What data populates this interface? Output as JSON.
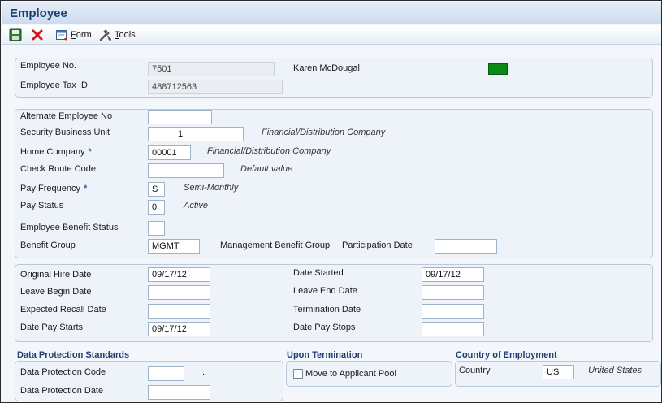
{
  "window": {
    "title": "Employee"
  },
  "toolbar": {
    "save_icon": "floppy-save-icon",
    "cancel_icon": "red-x-cancel-icon",
    "form_label_underline": "F",
    "form_label_rest": "orm",
    "tools_label_underline": "T",
    "tools_label_rest": "ools"
  },
  "header": {
    "employee_no_label": "Employee No.",
    "employee_no": "7501",
    "employee_name": "Karen McDougal",
    "tax_id_label": "Employee Tax ID",
    "tax_id": "488712563",
    "status_color": "#0a8a14"
  },
  "details": {
    "alt_employee_label": "Alternate Employee No",
    "alt_employee_value": "",
    "security_bu_label": "Security Business Unit",
    "security_bu_value": "1",
    "security_bu_desc": "Financial/Distribution Company",
    "home_company_label": "Home Company",
    "home_company_value": "00001",
    "home_company_desc": "Financial/Distribution Company",
    "check_route_label": "Check Route Code",
    "check_route_value": "",
    "check_route_desc": "Default value",
    "pay_frequency_label": "Pay Frequency",
    "pay_frequency_value": "S",
    "pay_frequency_desc": "Semi-Monthly",
    "pay_status_label": "Pay Status",
    "pay_status_value": "0",
    "pay_status_desc": "Active",
    "benefit_status_label": "Employee Benefit Status",
    "benefit_status_value": "",
    "benefit_group_label": "Benefit Group",
    "benefit_group_value": "MGMT",
    "benefit_group_desc": "Management Benefit Group",
    "participation_date_label": "Participation Date",
    "participation_date_value": "",
    "required_marker": "*"
  },
  "dates": {
    "original_hire_label": "Original Hire Date",
    "original_hire_value": "09/17/12",
    "date_started_label": "Date Started",
    "date_started_value": "09/17/12",
    "leave_begin_label": "Leave Begin Date",
    "leave_begin_value": "",
    "leave_end_label": "Leave End Date",
    "leave_end_value": "",
    "expected_recall_label": "Expected Recall Date",
    "expected_recall_value": "",
    "termination_label": "Termination Date",
    "termination_value": "",
    "pay_starts_label": "Date Pay Starts",
    "pay_starts_value": "09/17/12",
    "pay_stops_label": "Date Pay Stops",
    "pay_stops_value": ""
  },
  "data_protection": {
    "title": "Data Protection Standards",
    "code_label": "Data Protection Code",
    "code_value": "",
    "code_desc": ".",
    "date_label": "Data Protection Date",
    "date_value": ""
  },
  "termination": {
    "title": "Upon Termination",
    "move_label": "Move to Applicant Pool"
  },
  "country": {
    "title": "Country of Employment",
    "label": "Country",
    "value": "US",
    "desc": "United States"
  }
}
